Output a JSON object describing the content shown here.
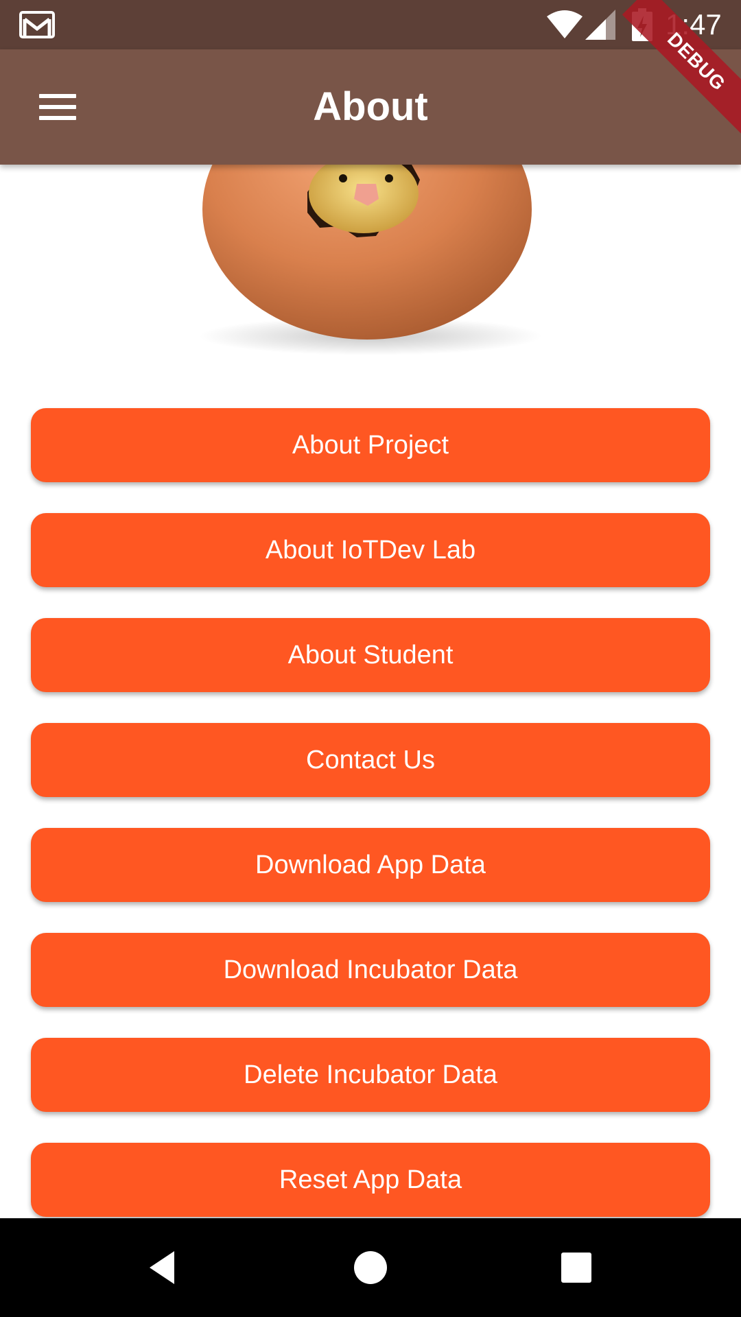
{
  "status_bar": {
    "time": "1:47",
    "icons": [
      "gmail-icon",
      "wifi-icon",
      "cell-signal-icon",
      "battery-charging-icon"
    ]
  },
  "debug_banner": {
    "label": "DEBUG"
  },
  "app_bar": {
    "title": "About",
    "menu_icon": "hamburger-menu-icon",
    "color": "#795548"
  },
  "hero_image": {
    "subject": "chick hatching from egg"
  },
  "buttons": [
    {
      "label": "About Project"
    },
    {
      "label": "About IoTDev Lab"
    },
    {
      "label": "About Student"
    },
    {
      "label": "Contact Us"
    },
    {
      "label": "Download App Data"
    },
    {
      "label": "Download Incubator Data"
    },
    {
      "label": "Delete Incubator Data"
    },
    {
      "label": "Reset App Data"
    }
  ],
  "colors": {
    "status_bar": "#5d4037",
    "app_bar": "#795548",
    "button": "#ff5722",
    "button_text": "#ffffff",
    "debug_ribbon": "#aa1923"
  },
  "nav_bar": {
    "icons": [
      "back-icon",
      "home-icon",
      "recents-icon"
    ]
  }
}
